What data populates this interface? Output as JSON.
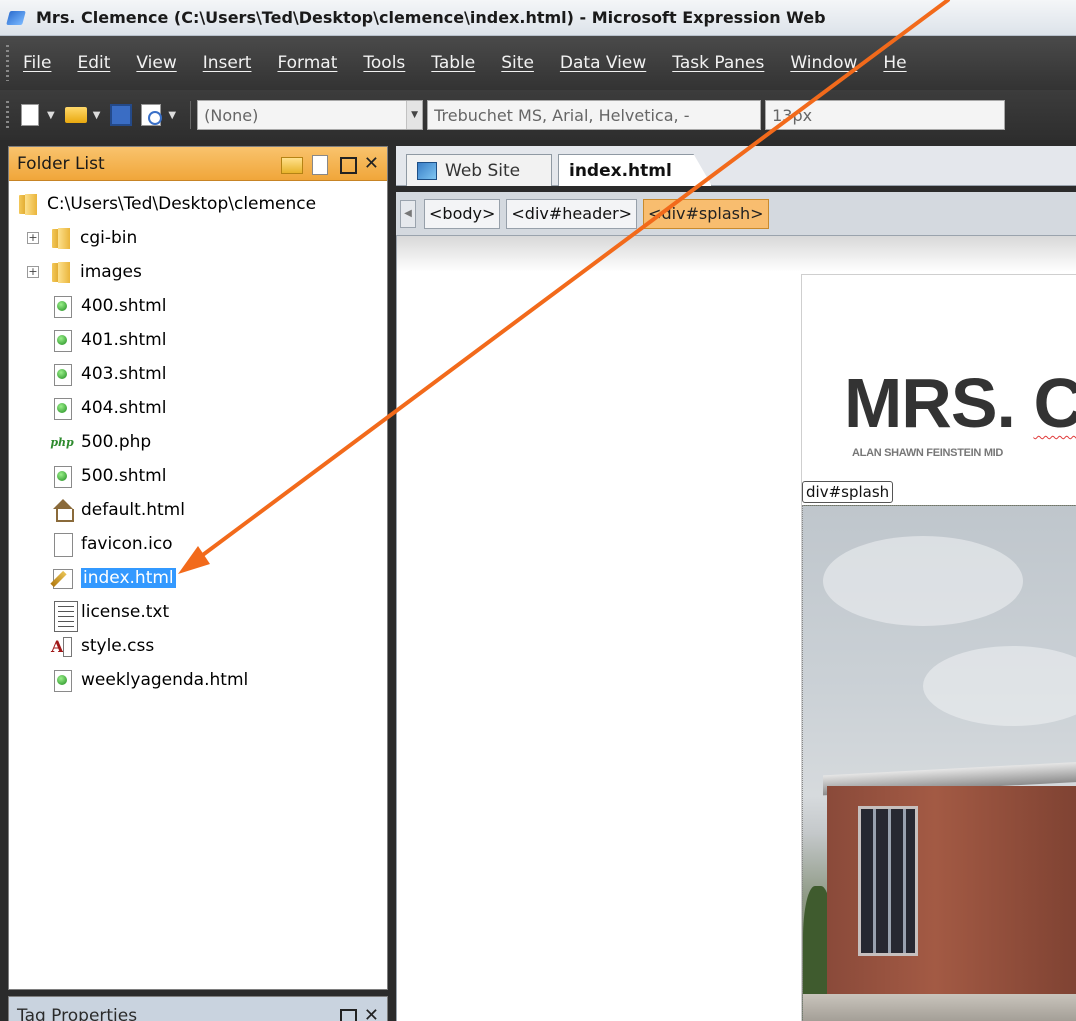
{
  "window": {
    "title": "Mrs. Clemence (C:\\Users\\Ted\\Desktop\\clemence\\index.html) - Microsoft Expression Web"
  },
  "menu": [
    "File",
    "Edit",
    "View",
    "Insert",
    "Format",
    "Tools",
    "Table",
    "Site",
    "Data View",
    "Task Panes",
    "Window",
    "He"
  ],
  "toolbar": {
    "style_combo": "(None)",
    "font_combo": "Trebuchet MS, Arial, Helvetica, -",
    "size_combo": "13px"
  },
  "folder_list": {
    "title": "Folder List",
    "root": "C:\\Users\\Ted\\Desktop\\clemence",
    "items": [
      {
        "label": "cgi-bin",
        "type": "folder"
      },
      {
        "label": "images",
        "type": "folder"
      },
      {
        "label": "400.shtml",
        "type": "page"
      },
      {
        "label": "401.shtml",
        "type": "page"
      },
      {
        "label": "403.shtml",
        "type": "page"
      },
      {
        "label": "404.shtml",
        "type": "page"
      },
      {
        "label": "500.php",
        "type": "php"
      },
      {
        "label": "500.shtml",
        "type": "page"
      },
      {
        "label": "default.html",
        "type": "home"
      },
      {
        "label": "favicon.ico",
        "type": "blank"
      },
      {
        "label": "index.html",
        "type": "edit",
        "selected": true
      },
      {
        "label": "license.txt",
        "type": "text"
      },
      {
        "label": "style.css",
        "type": "css"
      },
      {
        "label": "weeklyagenda.html",
        "type": "page"
      }
    ]
  },
  "tag_properties": {
    "title": "Tag Properties"
  },
  "tabs": {
    "website": "Web Site",
    "index": "index.html"
  },
  "breadcrumbs": [
    "<body>",
    "<div#header>",
    "<div#splash>"
  ],
  "design": {
    "site_title_a": "MRS. ",
    "site_title_b": "CL",
    "subtitle": "ALAN SHAWN FEINSTEIN MID",
    "div_label": "div#splash"
  },
  "colors": {
    "panel_header": "#f0a63a",
    "selection": "#3399ff",
    "arrow": "#f26a1b"
  }
}
